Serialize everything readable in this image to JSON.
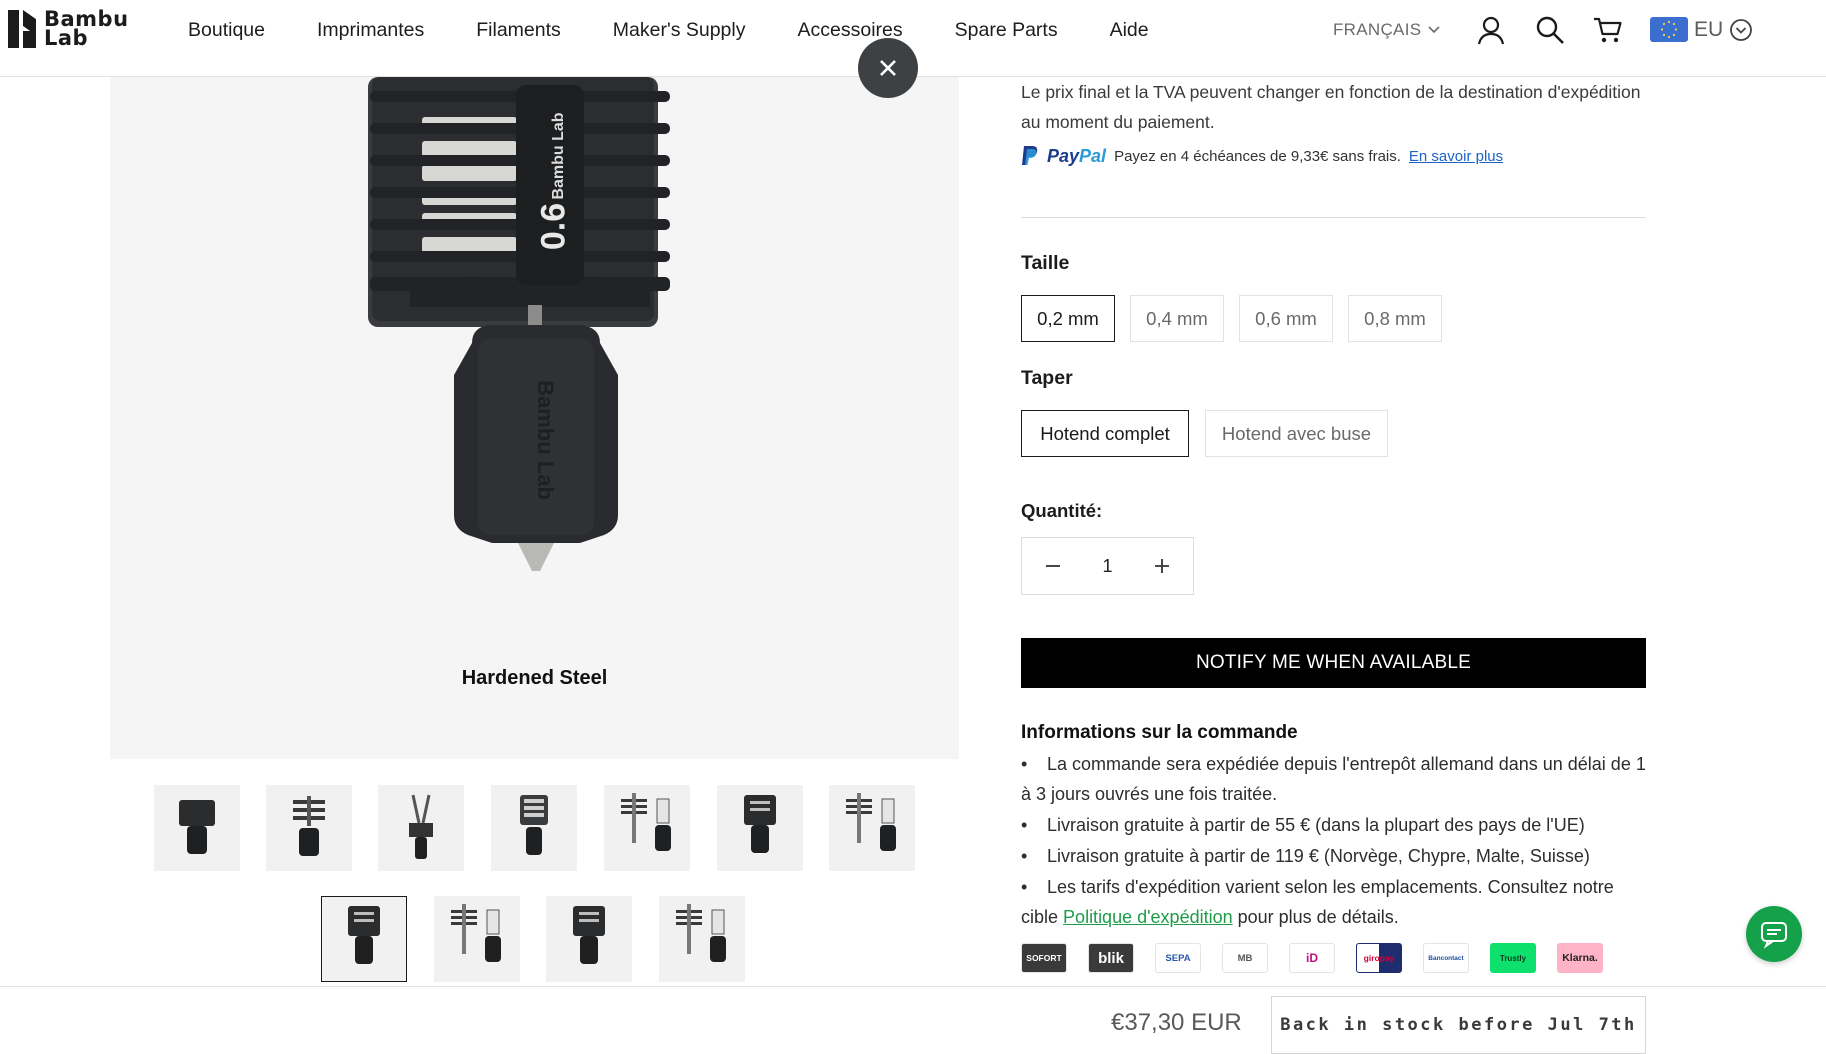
{
  "brand": {
    "line1": "Bambu",
    "line2": "Lab"
  },
  "nav": {
    "items": [
      "Boutique",
      "Imprimantes",
      "Filaments",
      "Maker's Supply",
      "Accessoires",
      "Spare Parts",
      "Aide"
    ]
  },
  "header": {
    "language": "FRANÇAIS",
    "region": "EU",
    "icons": [
      "account-icon",
      "search-icon",
      "cart-icon"
    ]
  },
  "media": {
    "caption": "Hardened Steel",
    "product_text_top": "0.6",
    "product_brand_cage": "Bambu Lab",
    "product_brand_sleeve": "Bambu Lab",
    "thumbnails_row1_count": 7,
    "thumbnails_row2_count": 4,
    "active_thumbnail_index": 7
  },
  "pricing_note": "Le prix final et la TVA peuvent changer en fonction de la destination d'expédition au moment du paiement.",
  "paypal": {
    "brand_pay": "Pay",
    "brand_pal": "Pal",
    "text": "Payez en 4 échéances de 9,33€ sans frais.",
    "link": "En savoir plus"
  },
  "size": {
    "label": "Taille",
    "options": [
      "0,2 mm",
      "0,4 mm",
      "0,6 mm",
      "0,8 mm"
    ],
    "selected": "0,2 mm"
  },
  "type": {
    "label": "Taper",
    "options": [
      "Hotend complet",
      "Hotend avec buse"
    ],
    "selected": "Hotend complet"
  },
  "quantity": {
    "label": "Quantité:",
    "value": "1"
  },
  "notify_button": "NOTIFY ME WHEN AVAILABLE",
  "order_info": {
    "title": "Informations sur la commande",
    "bullets": [
      "La commande sera expédiée depuis l'entrepôt allemand dans un délai de 1 à 3 jours ouvrés une fois traitée.",
      "Livraison gratuite à partir de 55 € (dans la plupart des pays de l'UE)",
      "Livraison gratuite à partir de 119 € (Norvège, Chypre, Malte, Suisse)"
    ],
    "last_bullet_prefix": "Les tarifs d'expédition varient selon les emplacements. Consultez notre cible",
    "last_bullet_link": "Politique d'expédition",
    "last_bullet_suffix": "pour plus de détails."
  },
  "payment_methods": [
    "SOFORT",
    "blik",
    "SEPA",
    "MB",
    "iD",
    "giropay",
    "Bancontact",
    "Trustly",
    "Klarna."
  ],
  "bottom_bar": {
    "price": "€37,30 EUR",
    "stock_button": "Back in stock before Jul 7th"
  },
  "colors": {
    "accent_black": "#000000",
    "link_blue": "#1a63c8",
    "link_green": "#1e9c4a",
    "chat_green": "#15a14a",
    "eu_blue": "#3a6fd0"
  }
}
